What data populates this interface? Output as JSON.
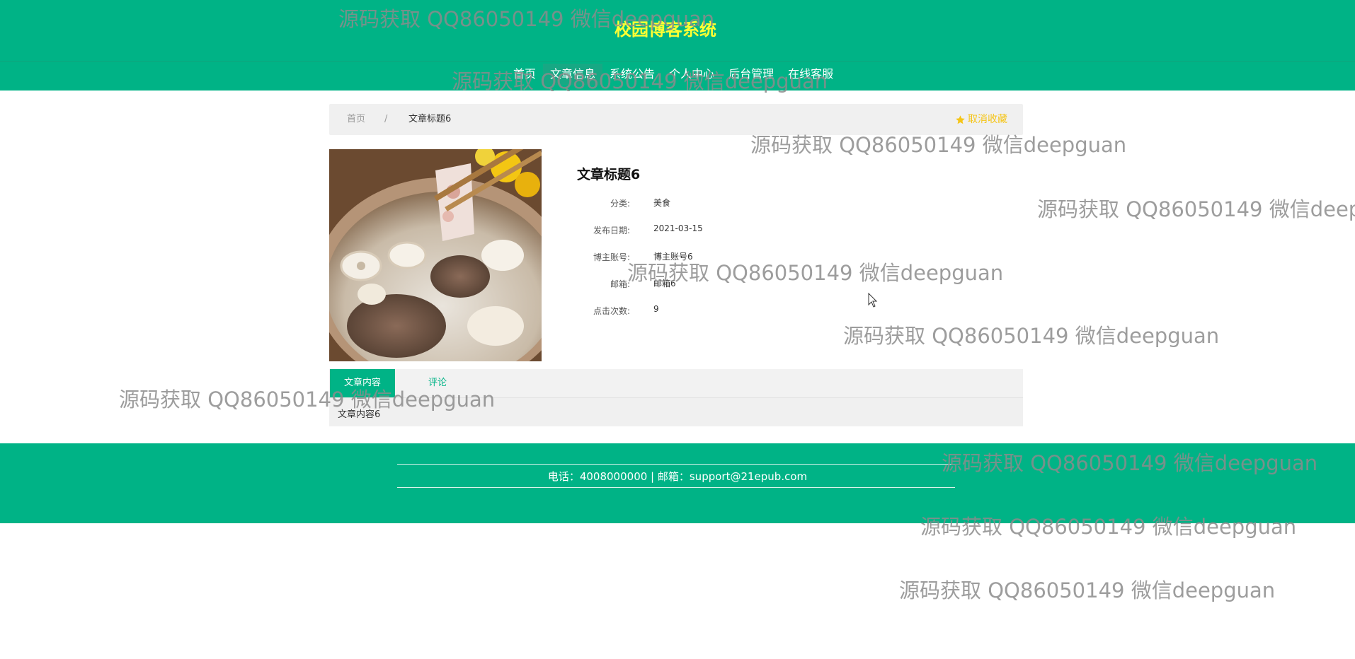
{
  "header": {
    "site_title": "校园博客系统",
    "nav": [
      "首页",
      "文章信息",
      "系统公告",
      "个人中心",
      "后台管理",
      "在线客服"
    ],
    "active_nav_index": 1
  },
  "breadcrumb": {
    "home": "首页",
    "separator": "/",
    "current": "文章标题6",
    "favorite_label": "取消收藏",
    "favorite_icon": "star-icon"
  },
  "article": {
    "image_alt": "lotus root and pork rib soup",
    "title": "文章标题6",
    "fields": [
      {
        "label": "分类:",
        "value": "美食"
      },
      {
        "label": "发布日期:",
        "value": "2021-03-15"
      },
      {
        "label": "博主账号:",
        "value": "博主账号6"
      },
      {
        "label": "邮箱:",
        "value": "邮箱6"
      },
      {
        "label": "点击次数:",
        "value": "9"
      }
    ]
  },
  "tabs": {
    "items": [
      "文章内容",
      "评论"
    ],
    "active_index": 0,
    "content": "文章内容6"
  },
  "footer": {
    "contact": "电话：4008000000 | 邮箱：support@21epub.com"
  },
  "watermark": "源码获取 QQ86050149 微信deepguan",
  "colors": {
    "primary": "#00b386",
    "title_yellow": "#ffff33",
    "favorite": "#f5c518",
    "panel_bg": "#f0f0f0"
  }
}
